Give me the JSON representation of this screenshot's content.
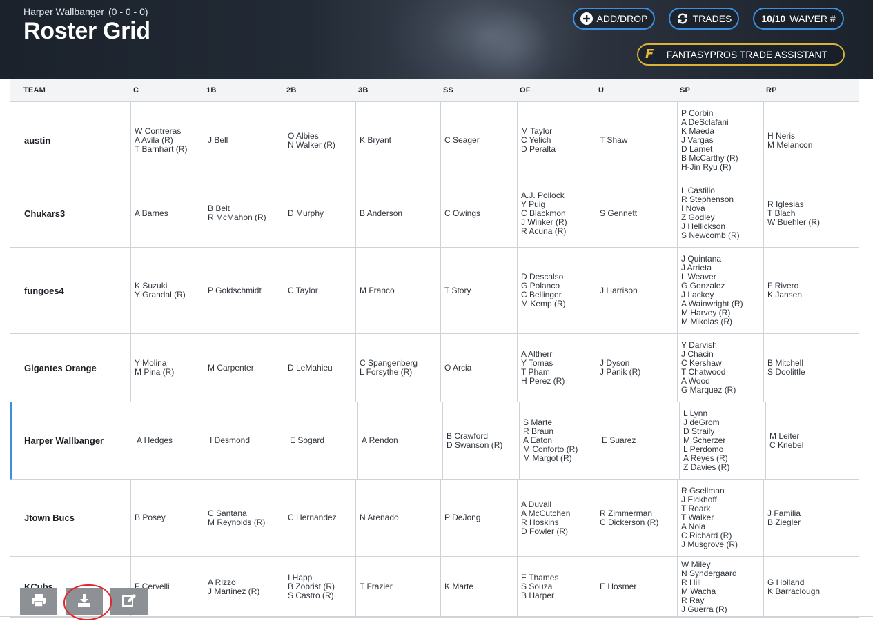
{
  "header": {
    "team_name": "Harper Wallbanger",
    "record": "(0 - 0 - 0)",
    "title": "Roster Grid",
    "add_drop_label": "ADD/DROP",
    "trades_label": "TRADES",
    "waiver_count": "10/10",
    "waiver_label": "WAIVER #",
    "fantasypros_label": "FANTASYPROS TRADE ASSISTANT",
    "fantasypros_logo": "F",
    "accent_color": "#3d8fe0",
    "fp_color": "#d8b43c"
  },
  "table": {
    "columns": [
      "TEAM",
      "C",
      "1B",
      "2B",
      "3B",
      "SS",
      "OF",
      "U",
      "SP",
      "RP"
    ],
    "rows": [
      {
        "team": "austin",
        "C": [
          "W Contreras",
          "A Avila (R)",
          "T Barnhart (R)"
        ],
        "1B": [
          "J Bell"
        ],
        "2B": [
          "O Albies",
          "N Walker (R)"
        ],
        "3B": [
          "K Bryant"
        ],
        "SS": [
          "C Seager"
        ],
        "OF": [
          "M Taylor",
          "C Yelich",
          "D Peralta"
        ],
        "U": [
          "T Shaw"
        ],
        "SP": [
          "P Corbin",
          "A DeSclafani",
          "K Maeda",
          "J Vargas",
          "D Lamet",
          "B McCarthy (R)",
          "H-Jin Ryu (R)"
        ],
        "RP": [
          "H Neris",
          "M Melancon"
        ]
      },
      {
        "team": "Chukars3",
        "C": [
          "A Barnes"
        ],
        "1B": [
          "B Belt",
          "R McMahon (R)"
        ],
        "2B": [
          "D Murphy"
        ],
        "3B": [
          "B Anderson"
        ],
        "SS": [
          "C Owings"
        ],
        "OF": [
          "A.J. Pollock",
          "Y Puig",
          "C Blackmon",
          "J Winker (R)",
          "R Acuna (R)"
        ],
        "U": [
          "S Gennett"
        ],
        "SP": [
          "L Castillo",
          "R Stephenson",
          "I Nova",
          "Z Godley",
          "J Hellickson",
          "S Newcomb (R)"
        ],
        "RP": [
          "R Iglesias",
          "T Blach",
          "W Buehler (R)"
        ]
      },
      {
        "team": "fungoes4",
        "C": [
          "K Suzuki",
          "Y Grandal (R)"
        ],
        "1B": [
          "P Goldschmidt"
        ],
        "2B": [
          "C Taylor"
        ],
        "3B": [
          "M Franco"
        ],
        "SS": [
          "T Story"
        ],
        "OF": [
          "D Descalso",
          "G Polanco",
          "C Bellinger",
          "M Kemp (R)"
        ],
        "U": [
          "J Harrison"
        ],
        "SP": [
          "J Quintana",
          "J Arrieta",
          "L Weaver",
          "G Gonzalez",
          "J Lackey",
          "A Wainwright (R)",
          "M Harvey (R)",
          "M Mikolas (R)"
        ],
        "RP": [
          "F Rivero",
          "K Jansen"
        ]
      },
      {
        "team": "Gigantes Orange",
        "C": [
          "Y Molina",
          "M Pina (R)"
        ],
        "1B": [
          "M Carpenter"
        ],
        "2B": [
          "D LeMahieu"
        ],
        "3B": [
          "C Spangenberg",
          "L Forsythe (R)"
        ],
        "SS": [
          "O Arcia"
        ],
        "OF": [
          "A Altherr",
          "Y Tomas",
          "T Pham",
          "H Perez (R)"
        ],
        "U": [
          "J Dyson",
          "J Panik (R)"
        ],
        "SP": [
          "Y Darvish",
          "J Chacin",
          "C Kershaw",
          "T Chatwood",
          "A Wood",
          "G Marquez (R)"
        ],
        "RP": [
          "B Mitchell",
          "S Doolittle"
        ]
      },
      {
        "team": "Harper Wallbanger",
        "active": true,
        "C": [
          "A Hedges"
        ],
        "1B": [
          "I Desmond"
        ],
        "2B": [
          "E Sogard"
        ],
        "3B": [
          "A Rendon"
        ],
        "SS": [
          "B Crawford",
          "D Swanson (R)"
        ],
        "OF": [
          "S Marte",
          "R Braun",
          "A Eaton",
          "M Conforto (R)",
          "M Margot (R)"
        ],
        "U": [
          "E Suarez"
        ],
        "SP": [
          "L Lynn",
          "J deGrom",
          "D Straily",
          "M Scherzer",
          "L Perdomo",
          "A Reyes (R)",
          "Z Davies (R)"
        ],
        "RP": [
          "M Leiter",
          "C Knebel"
        ]
      },
      {
        "team": "Jtown Bucs",
        "C": [
          "B Posey"
        ],
        "1B": [
          "C Santana",
          "M Reynolds (R)"
        ],
        "2B": [
          "C Hernandez"
        ],
        "3B": [
          "N Arenado"
        ],
        "SS": [
          "P DeJong"
        ],
        "OF": [
          "A Duvall",
          "A McCutchen",
          "R Hoskins",
          "D Fowler (R)"
        ],
        "U": [
          "R Zimmerman",
          "C Dickerson (R)"
        ],
        "SP": [
          "R Gsellman",
          "J Eickhoff",
          "T Roark",
          "T Walker",
          "A Nola",
          "C Richard (R)",
          "J Musgrove (R)"
        ],
        "RP": [
          "J Familia",
          "B Ziegler"
        ]
      },
      {
        "team": "KCubs",
        "C": [
          "F Cervelli"
        ],
        "1B": [
          "A Rizzo",
          "J Martinez (R)"
        ],
        "2B": [
          "I Happ",
          "B Zobrist (R)",
          "S Castro (R)"
        ],
        "3B": [
          "T Frazier"
        ],
        "SS": [
          "K Marte"
        ],
        "OF": [
          "E Thames",
          "S Souza",
          "B Harper"
        ],
        "U": [
          "E Hosmer"
        ],
        "SP": [
          "W Miley",
          "N Syndergaard",
          "R Hill",
          "M Wacha",
          "R Ray",
          "J Guerra (R)"
        ],
        "RP": [
          "G Holland",
          "K Barraclough"
        ]
      }
    ]
  },
  "toolbar": {
    "print_icon": "printer-icon",
    "download_icon": "download-icon",
    "edit_icon": "edit-icon"
  }
}
